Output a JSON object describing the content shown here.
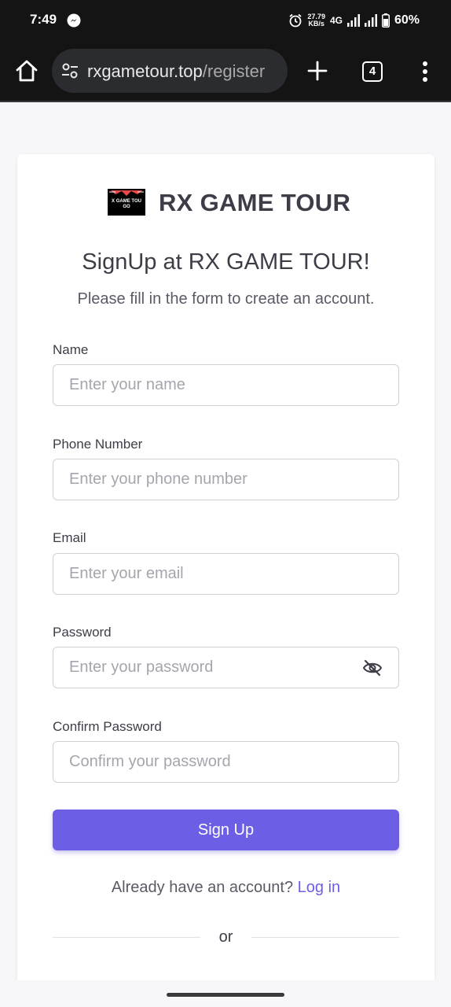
{
  "status_bar": {
    "time": "7:49",
    "net_speed_value": "27.79",
    "net_speed_unit": "KB/s",
    "network": "4G",
    "battery": "60%"
  },
  "browser": {
    "url_domain": "rxgametour.top",
    "url_path": "/register",
    "tab_count": "4"
  },
  "brand": {
    "name": "RX GAME TOUR",
    "logo_text": "X GAME TOU\nGO"
  },
  "form": {
    "title": "SignUp at RX GAME TOUR!",
    "subtitle": "Please fill in the form to create an account.",
    "name_label": "Name",
    "name_placeholder": "Enter your name",
    "phone_label": "Phone Number",
    "phone_placeholder": "Enter your phone number",
    "email_label": "Email",
    "email_placeholder": "Enter your email",
    "password_label": "Password",
    "password_placeholder": "Enter your password",
    "confirm_label": "Confirm Password",
    "confirm_placeholder": "Confirm your password",
    "submit_label": "Sign Up",
    "login_prompt": "Already have an account?",
    "login_link": "Log in",
    "divider_text": "or"
  },
  "colors": {
    "accent": "#6c5fe6",
    "text": "#3e3c47",
    "browser_bg": "#141414"
  },
  "icons": [
    "messenger-icon",
    "alarm-icon",
    "signal-icon",
    "battery-icon",
    "home-icon",
    "site-settings-icon",
    "plus-icon",
    "tabs-icon",
    "more-vert-icon",
    "eye-off-icon"
  ]
}
